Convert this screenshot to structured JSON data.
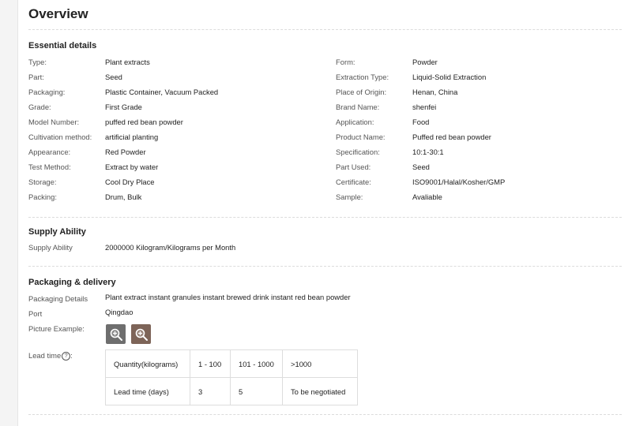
{
  "overview": {
    "title": "Overview"
  },
  "essential": {
    "title": "Essential details",
    "left": [
      {
        "key": "Type:",
        "value": "Plant extracts"
      },
      {
        "key": "Part:",
        "value": "Seed"
      },
      {
        "key": "Packaging:",
        "value": "Plastic Container, Vacuum Packed"
      },
      {
        "key": "Grade:",
        "value": "First Grade"
      },
      {
        "key": "Model Number:",
        "value": "puffed red bean powder"
      },
      {
        "key": "Cultivation method:",
        "value": "artificial planting"
      },
      {
        "key": "Appearance:",
        "value": "Red Powder"
      },
      {
        "key": "Test Method:",
        "value": "Extract by water"
      },
      {
        "key": "Storage:",
        "value": "Cool Dry Place"
      },
      {
        "key": "Packing:",
        "value": "Drum, Bulk"
      }
    ],
    "right": [
      {
        "key": "Form:",
        "value": "Powder"
      },
      {
        "key": "Extraction Type:",
        "value": "Liquid-Solid Extraction"
      },
      {
        "key": "Place of Origin:",
        "value": "Henan, China"
      },
      {
        "key": "Brand Name:",
        "value": "shenfei"
      },
      {
        "key": "Application:",
        "value": "Food"
      },
      {
        "key": "Product Name:",
        "value": "Puffed red bean powder"
      },
      {
        "key": "Specification:",
        "value": "10:1-30:1"
      },
      {
        "key": "Part Used:",
        "value": "Seed"
      },
      {
        "key": "Certificate:",
        "value": "ISO9001/Halal/Kosher/GMP"
      },
      {
        "key": "Sample:",
        "value": "Avaliable"
      }
    ]
  },
  "supply": {
    "title": "Supply Ability",
    "key": "Supply Ability",
    "value": "2000000 Kilogram/Kilograms per Month"
  },
  "packaging": {
    "title": "Packaging & delivery",
    "details_key": "Packaging Details",
    "details_value": "Plant extract instant granules instant brewed drink instant red bean powder",
    "port_key": "Port",
    "port_value": "Qingdao",
    "picture_key": "Picture Example:",
    "lead_key": "Lead time",
    "help_glyph": "?"
  },
  "lead_table": {
    "header": [
      "Quantity(kilograms)",
      "1 - 100",
      "101 - 1000",
      ">1000"
    ],
    "row": [
      "Lead time (days)",
      "3",
      "5",
      "To be negotiated"
    ]
  },
  "icons": {
    "zoom": "zoom-icon"
  }
}
